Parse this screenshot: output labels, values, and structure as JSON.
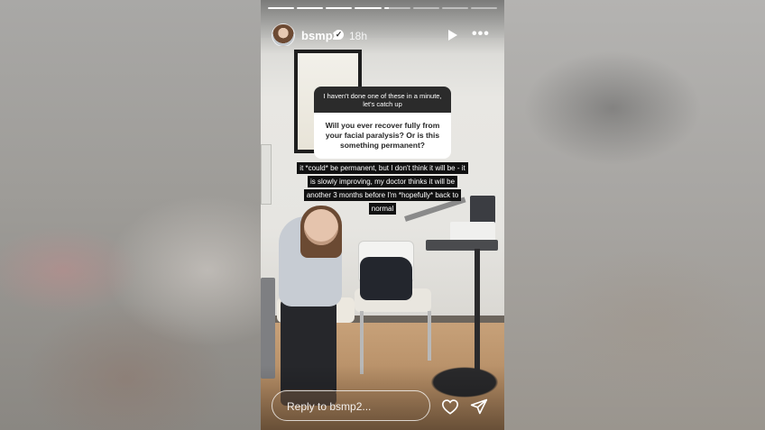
{
  "story": {
    "username": "bsmp2",
    "timestamp": "18h",
    "progress_segments": [
      1,
      1,
      1,
      1,
      0.2,
      0,
      0,
      0
    ]
  },
  "question_box": {
    "prompt": "I haven't done one of these in a minute, let's catch up",
    "question": "Will you ever recover fully from your facial paralysis? Or is this something permanent?"
  },
  "answer": "it *could* be permanent, but I don't think it will be - it is slowly improving, my doctor thinks it will be another 3 months before I'm *hopefully* back to normal",
  "reply": {
    "placeholder": "Reply to bsmp2..."
  },
  "icons": {
    "verified": "verified-badge-icon",
    "play": "play-icon",
    "more": "more-icon",
    "like": "heart-icon",
    "send": "send-icon"
  }
}
